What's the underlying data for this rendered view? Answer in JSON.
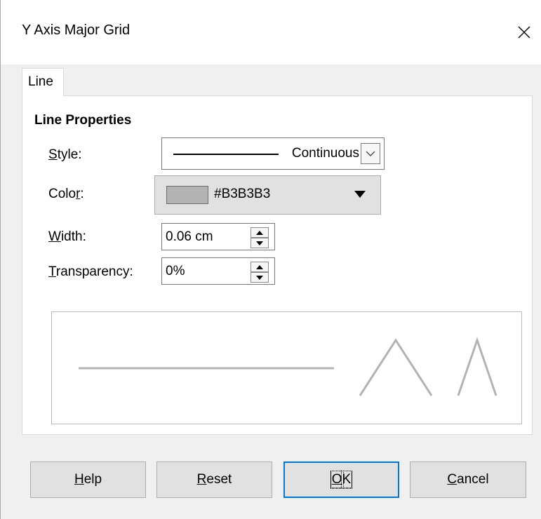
{
  "window": {
    "title": "Y Axis Major Grid"
  },
  "tabs": [
    {
      "label": "Line"
    }
  ],
  "line_properties": {
    "section_title": "Line Properties",
    "style": {
      "label_u": "S",
      "label_rest": "tyle:",
      "value": "Continuous"
    },
    "color": {
      "label_pre": "Colo",
      "label_u": "r",
      "label_post": ":",
      "value": "#B3B3B3",
      "swatch_color": "#B3B3B3"
    },
    "width": {
      "label_u": "W",
      "label_rest": "idth:",
      "value": "0.06 cm"
    },
    "transparency": {
      "label_u": "T",
      "label_rest": "ransparency:",
      "value": "0%"
    }
  },
  "preview": {
    "line_color": "#B3B3B3"
  },
  "buttons": {
    "help": {
      "u": "H",
      "rest": "elp"
    },
    "reset": {
      "u": "R",
      "rest": "eset"
    },
    "ok": {
      "u": "O",
      "rest": "K"
    },
    "cancel": {
      "u": "C",
      "rest": "ancel"
    }
  }
}
